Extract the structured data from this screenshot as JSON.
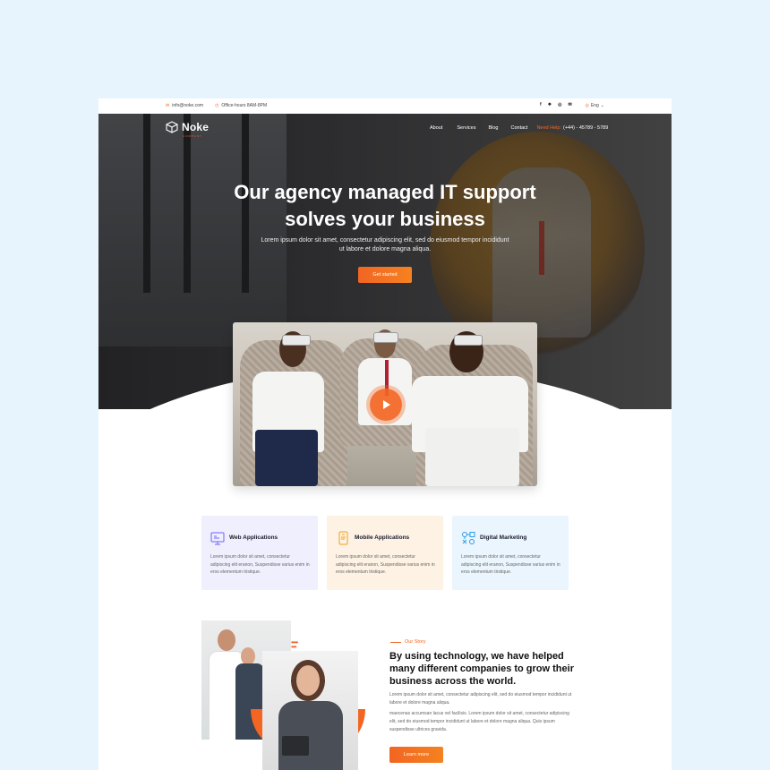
{
  "topbar": {
    "email": "info@noke.com",
    "hours": "Office-hours 8AM-8PM",
    "social": [
      "f",
      "❖",
      "◎",
      "✉"
    ],
    "lang": "Eng"
  },
  "nav": {
    "logo": "Noke",
    "logo_sub": "COMPANY",
    "menu": [
      "About",
      "Services",
      "Blog",
      "Contact"
    ],
    "need_help": "Need Help:",
    "phone": "(+44) - 45789 - 5789"
  },
  "hero": {
    "title_line1": "Our agency managed IT support",
    "title_line2": "solves your business",
    "text": "Lorem ipsum dolor sit amet, consectetur adipiscing elit, sed do eiusmod tempor incididunt ut labore et dolore magna aliqua.",
    "cta": "Get started"
  },
  "services": [
    {
      "title": "Web Applications",
      "text": "Lorem ipsum dolor sit amet, consectetur adipiscing elit eranon, Suspendisse varius enim in eros elementum tristique.",
      "bg": "#efeffd",
      "icon": "web-app-icon"
    },
    {
      "title": "Mobile Applications",
      "text": "Lorem ipsum dolor sit amet, consectetur adipiscing elit eranon, Suspendisse varius enim in eros elementum tristique.",
      "bg": "#fdf2e3",
      "icon": "mobile-app-icon"
    },
    {
      "title": "Digital Marketing",
      "text": "Lorem ipsum dolor sit amet, consectetur adipiscing elit eranon, Suspendisse varius enim in eros elementum tristique.",
      "bg": "#eaf5fd",
      "icon": "marketing-icon"
    }
  ],
  "story": {
    "label": "Our Story",
    "title": "By using technology, we have helped many different companies to grow their business across the world.",
    "p1": "Lorem ipsum dolor sit amet, consectetur adipiscing elit, sed do eiusmod tempor incididunt ut labore et dolore magna aliqua.",
    "p2": "maecenas accumsan lacus vel facilisis. Lorem ipsum dolor sit amet, consectetur adipiscing elit, sed do eiusmod tempor incididunt ut labore et dolore magna aliqua. Quis ipsum suspendisse ultrices gravida.",
    "cta": "Learn more"
  },
  "colors": {
    "accent": "#f26522",
    "page_bg": "#e8f4fd"
  }
}
